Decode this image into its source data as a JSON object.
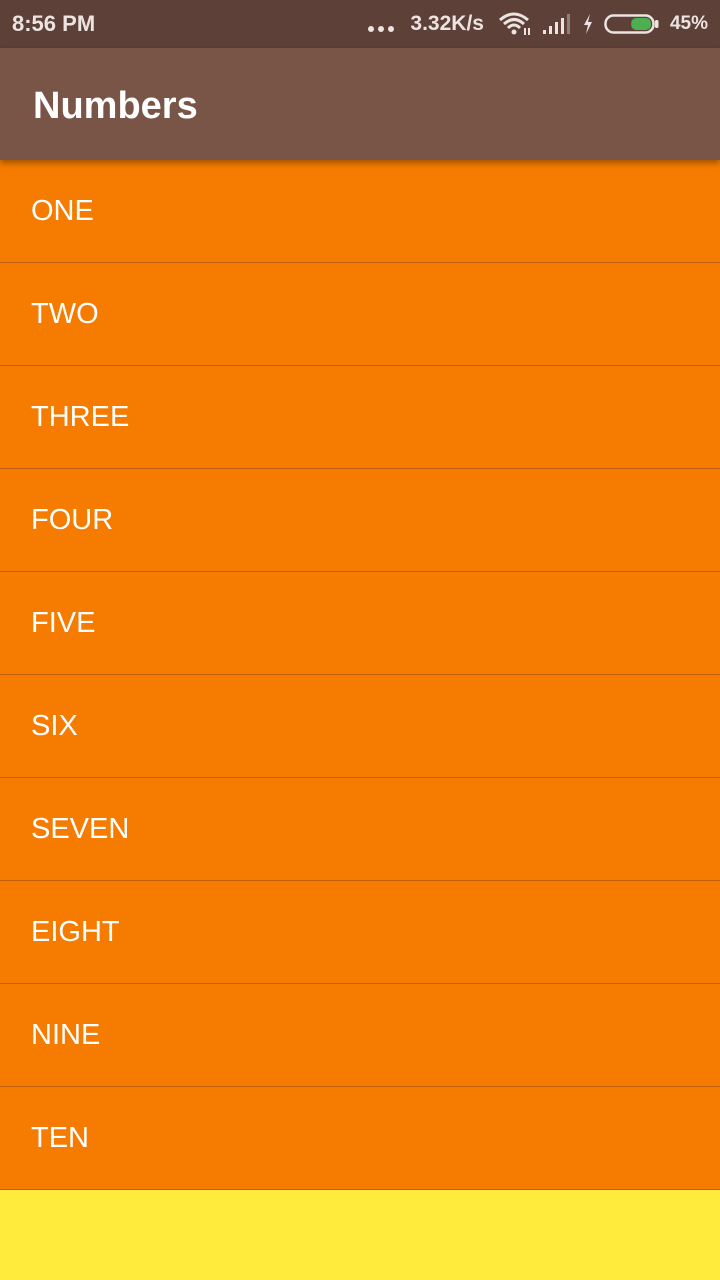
{
  "status_bar": {
    "time": "8:56 PM",
    "network_speed": "3.32K/s",
    "battery_percent": "45%",
    "icons": [
      "more-dots-icon",
      "wifi-icon",
      "cellular-signal-icon",
      "charging-bolt-icon",
      "battery-icon"
    ],
    "battery_level": 0.45
  },
  "app_bar": {
    "title": "Numbers"
  },
  "list": {
    "items": [
      {
        "label": "ONE"
      },
      {
        "label": "TWO"
      },
      {
        "label": "THREE"
      },
      {
        "label": "FOUR"
      },
      {
        "label": "FIVE"
      },
      {
        "label": "SIX"
      },
      {
        "label": "SEVEN"
      },
      {
        "label": "EIGHT"
      },
      {
        "label": "NINE"
      },
      {
        "label": "TEN"
      }
    ]
  },
  "colors": {
    "status_bar": "#5d4037",
    "app_bar": "#795548",
    "list_item_background": "#f57c00",
    "page_background": "#ffeb3b",
    "battery_fill": "#4caf50"
  }
}
